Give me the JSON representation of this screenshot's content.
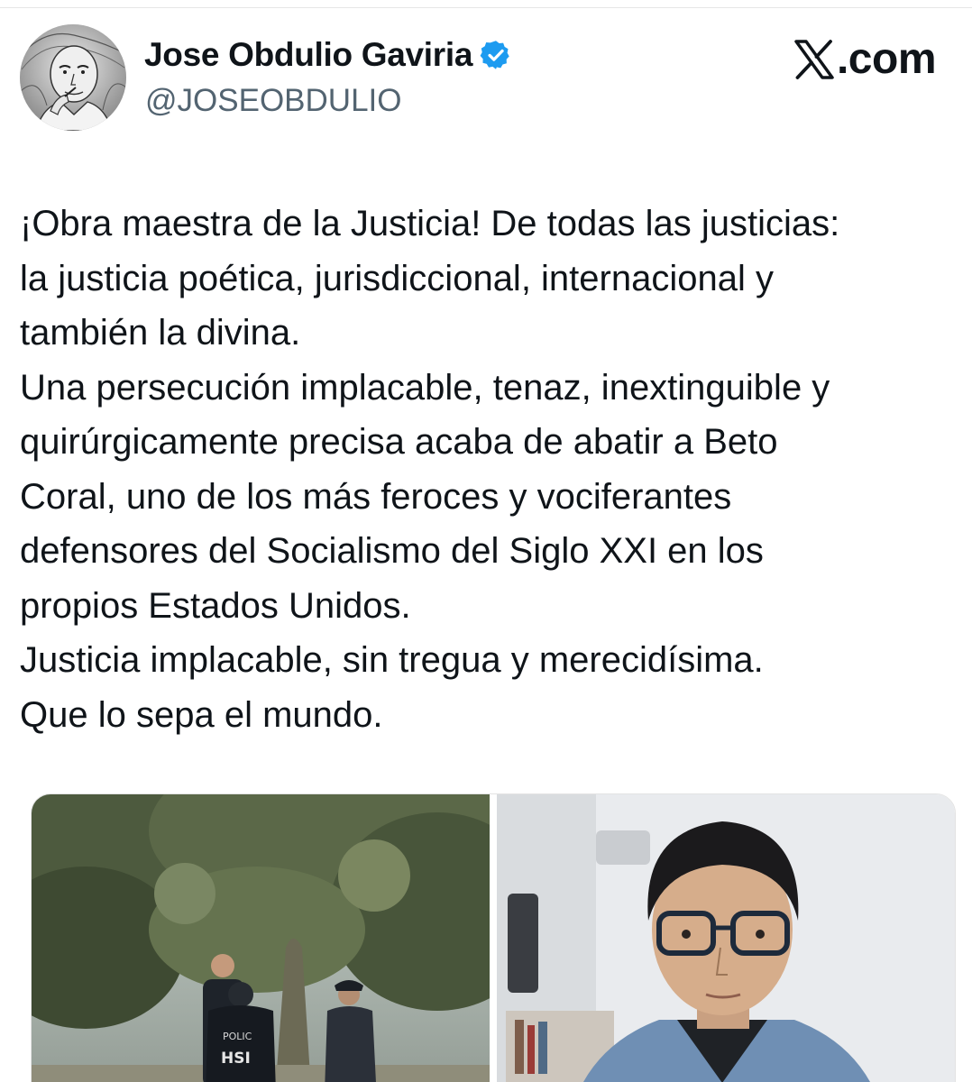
{
  "brand": {
    "label": ".com",
    "logo_icon": "x-logo-icon"
  },
  "author": {
    "name": "Jose Obdulio Gaviria",
    "handle": "@JOSEOBDULIO",
    "verified_icon": "verified-badge-icon",
    "avatar_icon": "avatar-illustration"
  },
  "tweet": {
    "lines": [
      "¡Obra maestra de la Justicia! De todas las justicias:",
      "la justicia poética, jurisdiccional, internacional y",
      "también la divina.",
      "Una persecución implacable, tenaz, inextinguible y",
      "quirúrgicamente precisa acaba de abatir a Beto",
      "Coral, uno de los más feroces y vociferantes",
      "defensores del Socialismo del Siglo XXI en los",
      "propios Estados Unidos.",
      "Justicia implacable, sin tregua y merecidísima.",
      "Que lo sepa el mundo."
    ]
  },
  "media": {
    "photos": [
      {
        "badge_line1": "POLIC",
        "badge_line2": "HSI"
      },
      {
        "subject": "portrait-with-glasses"
      }
    ]
  },
  "colors": {
    "text": "#0f1419",
    "handle": "#536471",
    "verified": "#1d9bf0"
  }
}
